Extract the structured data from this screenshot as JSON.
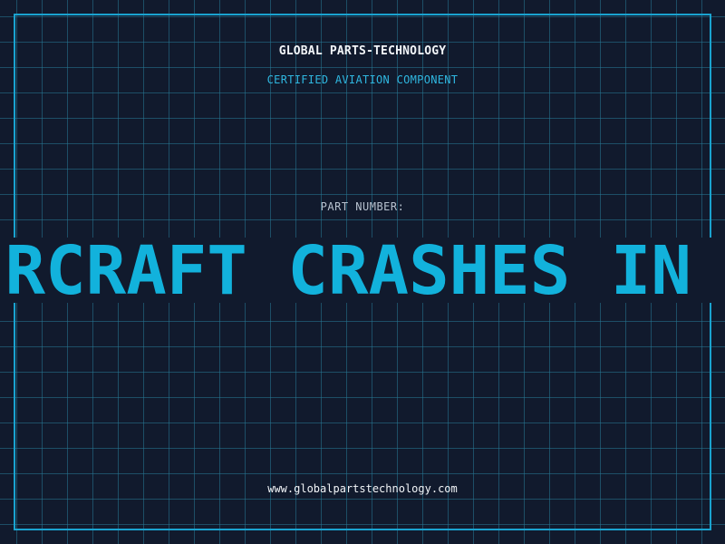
{
  "header": {
    "company": "GLOBAL PARTS-TECHNOLOGY",
    "subtitle": "CERTIFIED AVIATION COMPONENT"
  },
  "part": {
    "label": "PART NUMBER:",
    "ticker": "IRCRAFT CRASHES IN"
  },
  "footer": {
    "url": "www.globalpartstechnology.com"
  },
  "colors": {
    "background": "#111a2d",
    "grid": "#267896",
    "accent": "#1aa3cf",
    "ticker": "#12b2dc",
    "text": "#f2f5f8"
  }
}
